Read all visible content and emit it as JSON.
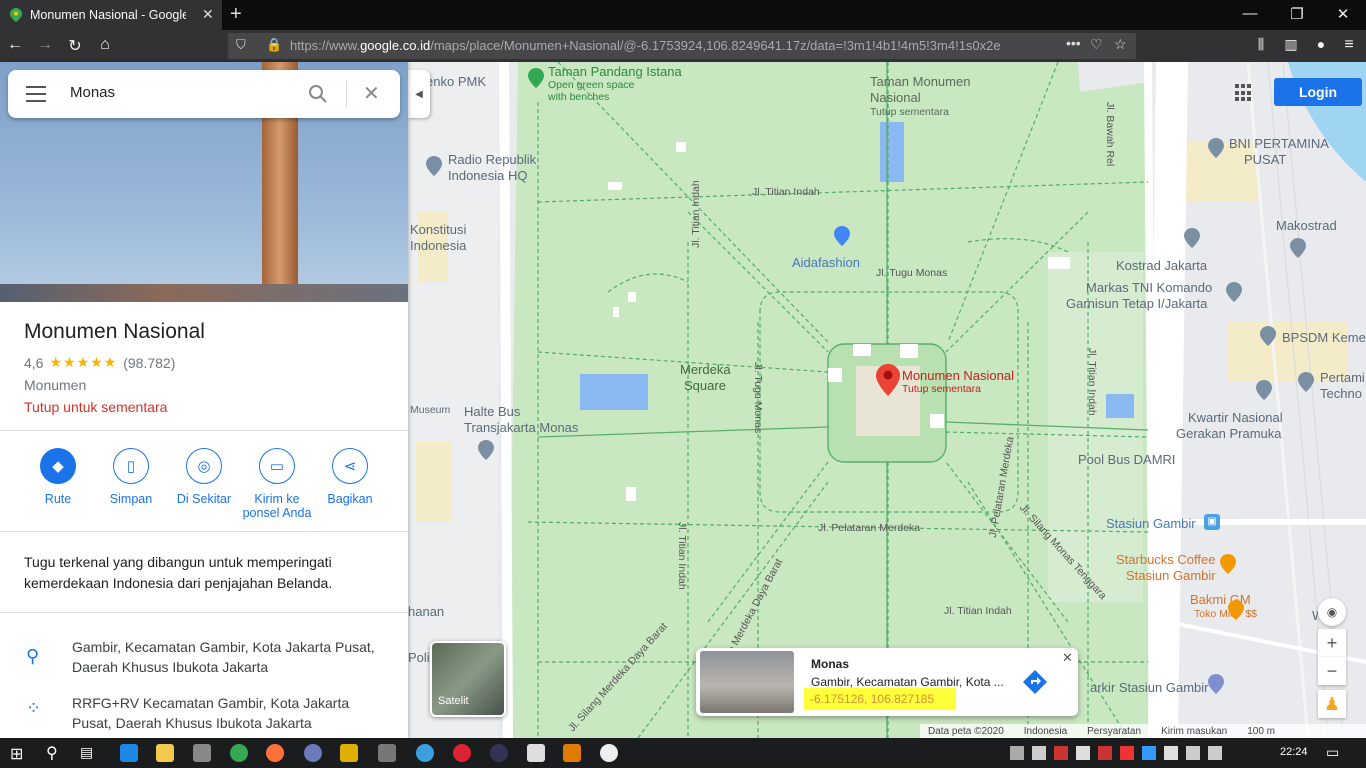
{
  "browser": {
    "tab_title": "Monumen Nasional - Google M",
    "url_prefix": "https://www.",
    "url_domain": "google.co.id",
    "url_rest": "/maps/place/Monumen+Nasional/@-6.1753924,106.8249641.17z/data=!3m1!4b1!4m5!3m4!1s0x2e"
  },
  "search": {
    "value": "Monas"
  },
  "place": {
    "title": "Monumen Nasional",
    "rating": "4,6",
    "stars": "★★★★★",
    "review_count": "(98.782)",
    "category": "Monumen",
    "status": "Tutup untuk sementara",
    "description": "Tugu terkenal yang dibangun untuk memperingati kemerdekaan Indonesia dari penjajahan Belanda."
  },
  "actions": [
    {
      "label": "Rute"
    },
    {
      "label": "Simpan"
    },
    {
      "label": "Di Sekitar"
    },
    {
      "label": "Kirim ke ponsel Anda"
    },
    {
      "label": "Bagikan"
    }
  ],
  "address": {
    "line": "Gambir, Kecamatan Gambir, Kota Jakarta Pusat, Daerah Khusus Ibukota Jakarta",
    "pluscode": "RRFG+RV Kecamatan Gambir, Kota Jakarta Pusat, Daerah Khusus Ibukota Jakarta"
  },
  "map_labels": {
    "taman_pandang": "Taman Pandang Istana",
    "taman_pandang_sub1": "Open green space",
    "taman_pandang_sub2": "with benches",
    "pmk": "emenko PMK",
    "taman_monumen": "Taman Monumen",
    "taman_monumen2": "Nasional",
    "taman_monumen_sub": "Tutup sementara",
    "rri": "Radio Republik",
    "rri2": "Indonesia HQ",
    "konstitusi": "Konstitusi",
    "konstitusi2": "Indonesia",
    "titian_indah_top": "Jl. Titian Indah",
    "aidafashion": "Aidafashion",
    "tugu_monas": "Jl. Tugu Monas",
    "merdeka_square": "Merdeka",
    "merdeka_square2": "Square",
    "monas_pin": "Monumen Nasional",
    "monas_pin_sub": "Tutup sementara",
    "museum": "Museum",
    "halte": "Halte Bus",
    "halte2": "Transjakarta Monas",
    "bni": "BNI PERTAMINA",
    "bni2": "PUSAT",
    "makostrad": "Makostrad",
    "kostrad": "Kostrad Jakarta",
    "markas": "Markas TNI Komando",
    "markas2": "Garnisun Tetap I/Jakarta",
    "bpsdm": "BPSDM Keme",
    "pertami": "Pertami",
    "pertami2": "Techno",
    "kwartir": "Kwartir Nasional",
    "kwartir2": "Gerakan Pramuka",
    "pool_bus": "Pool Bus DAMRI",
    "stasiun_gambir": "Stasiun Gambir",
    "starbucks": "Starbucks Coffee",
    "starbucks2": "Stasiun Gambir",
    "bakmi": "Bakmi GM",
    "bakmi_sub": "Toko Mie · $$",
    "wis": "Wis",
    "parkir": "arkir Stasiun Gambir",
    "pelataran": "Jl. Pelataran Merdeka",
    "titian_bottom": "Jl. Titian Indah",
    "hanan": "hanan",
    "poli": "Poli",
    "bawah_rel": "Jl. Bawah Rel",
    "titian_left": "Jl. Titian Indah",
    "titian_left2": "Jl. Titian Indah",
    "tugu_monas_v": "Jl. Tugu Monas",
    "titian_right": "Jl. Titian Indah",
    "pelataran_r": "Jl. Pelataran Merdeka",
    "silang_tenggara": "Jl. Silang Monas Tenggara",
    "silang_barat": "Jl. Silang Merdeka Daya Barat",
    "silang_barat2": "Jl. Silang Merdeka Daya Barat"
  },
  "popup": {
    "name": "Monas",
    "address": "Gambir, Kecamatan Gambir, Kota ...",
    "coords": "-6.175126, 106.827185"
  },
  "map_ui": {
    "login": "Login",
    "satelit": "Satelit",
    "zoom_in": "+",
    "zoom_out": "−",
    "footer_data": "Data peta ©2020",
    "footer_country": "Indonesia",
    "footer_terms": "Persyaratan",
    "footer_feedback": "Kirim masukan",
    "footer_scale": "100 m"
  },
  "taskbar": {
    "time": "22:24"
  },
  "colors": {
    "accent": "#1a73e8",
    "status_red": "#d93025",
    "park_green": "#c8e6c0",
    "highlight": "#ffff3b"
  }
}
